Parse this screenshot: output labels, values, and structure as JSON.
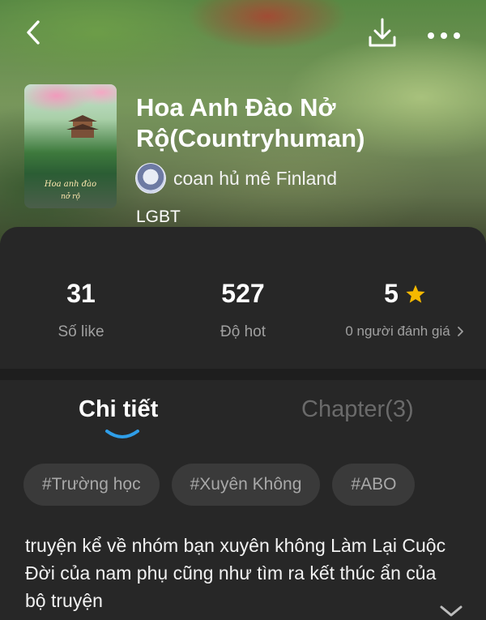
{
  "story": {
    "title": "Hoa Anh Đào Nở Rộ(Countryhuman)",
    "author": "coan hủ mê Finland",
    "genre": "LGBT",
    "cover_text": {
      "line1": "Hoa anh đào",
      "line2": "nở rộ"
    }
  },
  "stats": {
    "likes": {
      "value": "31",
      "label": "Số like"
    },
    "hot": {
      "value": "527",
      "label": "Độ hot"
    },
    "rating": {
      "value": "5",
      "label": "0 người đánh giá"
    }
  },
  "tabs": {
    "detail": "Chi tiết",
    "chapter": "Chapter(3)"
  },
  "tags": [
    "#Trường học",
    "#Xuyên Không",
    "#ABO"
  ],
  "description": "truyện kể về nhóm bạn xuyên không Làm Lại Cuộc Đời của nam phụ cũng như tìm ra kết thúc ẩn của bộ truyện",
  "icons": {
    "back": "back-arrow-icon",
    "download": "download-icon",
    "more": "more-icon",
    "star": "star-icon",
    "chevron": "chevron-right-icon",
    "expand": "chevron-down-icon"
  },
  "colors": {
    "background": "#272727",
    "accent_indicator": "#2f9ee8",
    "star": "#f5b800",
    "tag_bg": "#3a3a3a"
  }
}
